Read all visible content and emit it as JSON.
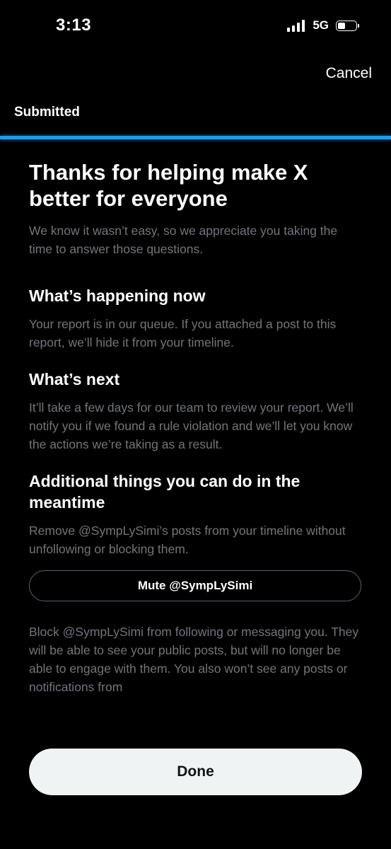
{
  "status_bar": {
    "time": "3:13",
    "network": "5G",
    "signal_bars": 4,
    "battery_level": 0.45
  },
  "header": {
    "cancel_label": "Cancel",
    "progress_label": "Submitted",
    "progress": 1.0,
    "accent_color": "#1d9bf0"
  },
  "main": {
    "title": "Thanks for helping make X better for everyone",
    "subtitle": "We know it wasn’t easy, so we appreciate you taking the time to answer those questions.",
    "sections": [
      {
        "heading": "What’s happening now",
        "body": "Your report is in our queue. If you attached a post to this report, we’ll hide it from your timeline."
      },
      {
        "heading": "What’s next",
        "body": "It’ll take a few days for our team to review your report. We’ll notify you if we found a rule violation and we’ll let you know the actions we’re taking as a result."
      },
      {
        "heading": "Additional things you can do in the meantime",
        "body": "Remove @SympLySimi’s posts from your timeline without unfollowing or blocking them."
      }
    ],
    "mute_button_label": "Mute @SympLySimi",
    "block_text": "Block @SympLySimi from following or messaging you. They will be able to see your public posts, but will no longer be able to engage with them. You also won’t see any posts or notifications from"
  },
  "footer": {
    "done_label": "Done"
  },
  "icons": [
    "signal-icon",
    "battery-icon"
  ]
}
